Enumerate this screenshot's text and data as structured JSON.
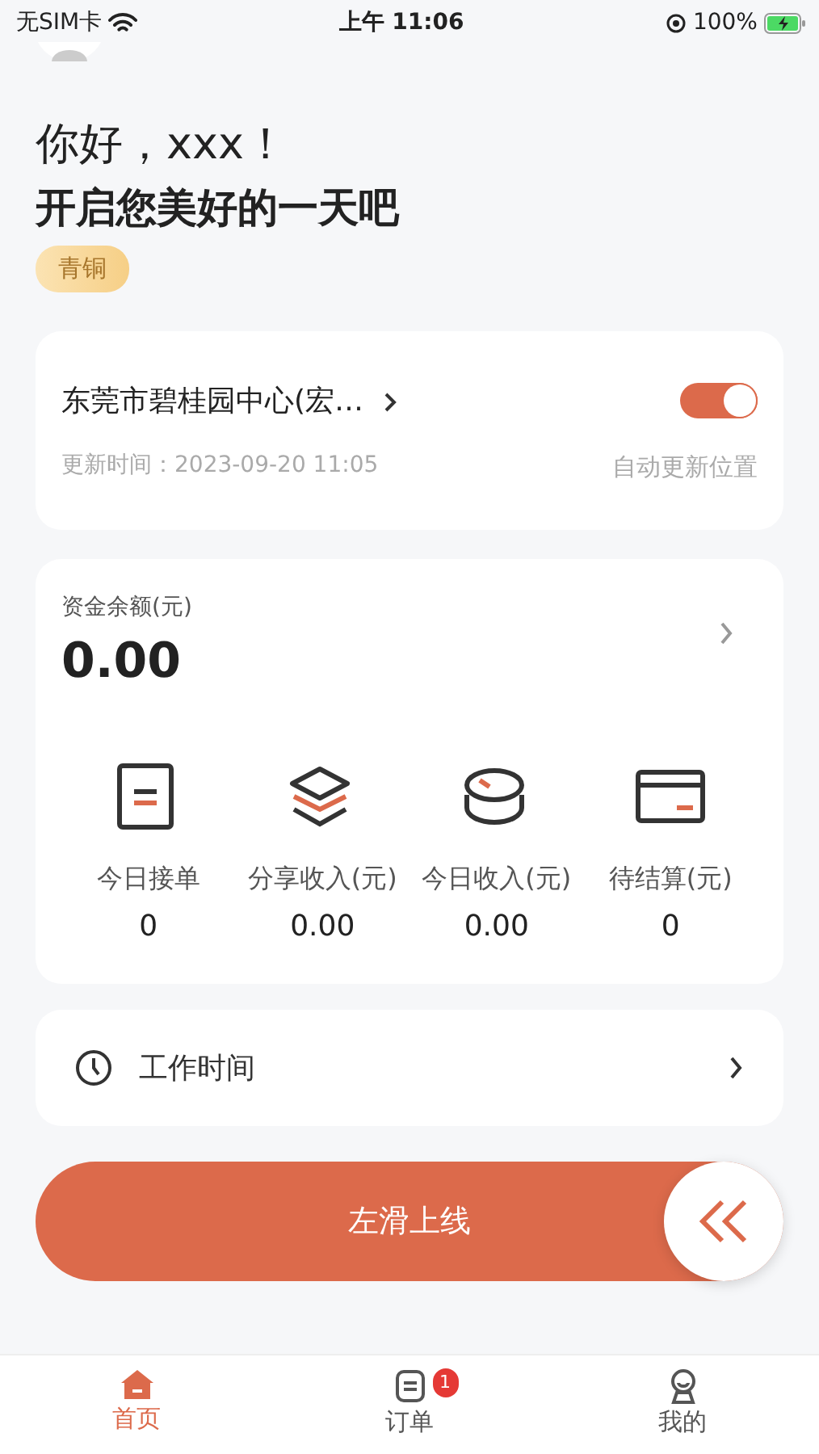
{
  "status_bar": {
    "carrier": "无SIM卡",
    "time": "上午 11:06",
    "battery": "100%"
  },
  "greeting": {
    "hello": "你好，xxx！",
    "subtitle": "开启您美好的一天吧",
    "level_badge": "青铜"
  },
  "location": {
    "address": "东莞市碧桂园中心(宏…",
    "updated": "更新时间：2023-09-20 11:05",
    "auto_update_label": "自动更新位置",
    "auto_update_on": true
  },
  "balance": {
    "label": "资金余额(元)",
    "amount": "0.00",
    "stats": [
      {
        "label": "今日接单",
        "value": "0"
      },
      {
        "label": "分享收入(元)",
        "value": "0.00"
      },
      {
        "label": "今日收入(元)",
        "value": "0.00"
      },
      {
        "label": "待结算(元)",
        "value": "0"
      }
    ]
  },
  "work_time": {
    "label": "工作时间"
  },
  "slide_button": {
    "label": "左滑上线"
  },
  "tabs": [
    {
      "label": "首页",
      "selected": true
    },
    {
      "label": "订单",
      "selected": false,
      "badge": "1"
    },
    {
      "label": "我的",
      "selected": false
    }
  ]
}
